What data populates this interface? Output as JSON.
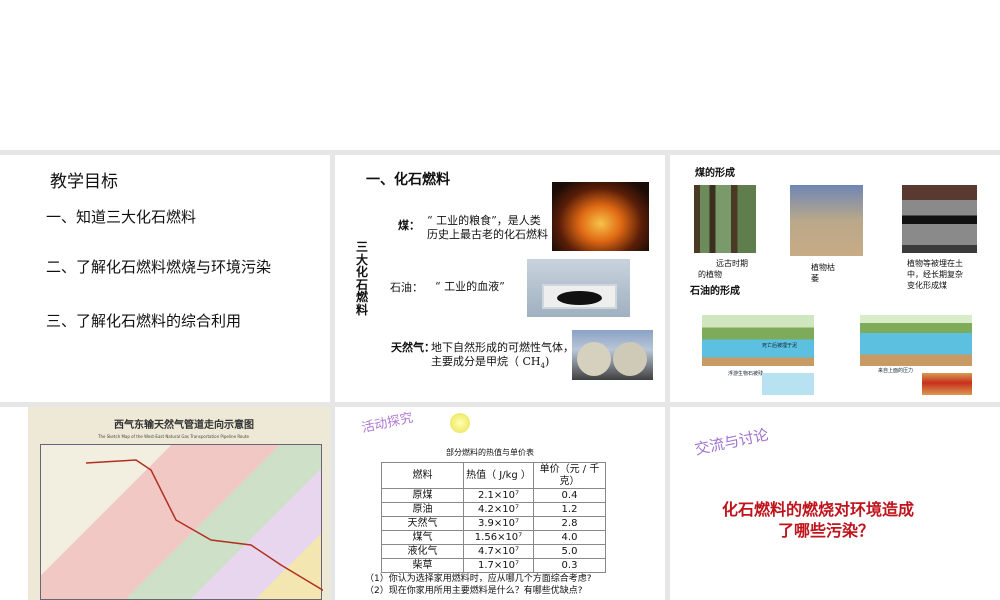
{
  "slide1": {
    "title": "教学目标",
    "items": [
      "一、知道三大化石燃料",
      "二、了解化石燃料燃烧与环境污染",
      "三、了解化石燃料的综合利用"
    ]
  },
  "slide2": {
    "title": "一、化石燃料",
    "side_label": "三大化石燃料",
    "coal_label": "煤：",
    "coal_text_1": "“ 工业的粮食”，是人类",
    "coal_text_2": "历史上最古老的化石燃料",
    "oil_label": "石油：",
    "oil_text": "“ 工业的血液”",
    "gas_label": "天然气：",
    "gas_text_1": "地下自然形成的可燃性气体，",
    "gas_text_2": "主要成分是甲烷（ CH",
    "gas_sub": "4",
    "gas_text_3": ")"
  },
  "slide3": {
    "coal_title": "煤的形成",
    "captions": [
      "远古时期的植物",
      "植物枯萎",
      "植物等被埋在土中，经长期复杂变化形成煤"
    ],
    "oil_title": "石油的形成",
    "oil_captions": [
      "死亡后被埋于泥",
      "浮游生物石被残",
      "来自上面的压力"
    ]
  },
  "slide4": {
    "title": "西气东输天然气管道走向示意图",
    "subtitle": "The Sketch Map of the West-East Natural Gas Transportation Pipeline Route"
  },
  "slide5": {
    "tag": "活动探究",
    "table_title": "部分燃料的热值与单价表",
    "headers": [
      "燃料",
      "热值（ J/kg ）",
      "单价（元 / 千克）"
    ],
    "rows": [
      [
        "原煤",
        "2.1×10⁷",
        "0.4"
      ],
      [
        "原油",
        "4.2×10⁷",
        "1.2"
      ],
      [
        "天然气",
        "3.9×10⁷",
        "2.8"
      ],
      [
        "煤气",
        "1.56×10⁷",
        "4.0"
      ],
      [
        "液化气",
        "4.7×10⁷",
        "5.0"
      ],
      [
        "柴草",
        "1.7×10⁷",
        "0.3"
      ]
    ],
    "q1": "（1）你认为选择家用燃料时，应从哪几个方面综合考虑?",
    "q2": "（2）现在你家用所用主要燃料是什么？有哪些优缺点?"
  },
  "slide6": {
    "tag": "交流与讨论",
    "question_1": "化石燃料的燃烧对环境造成",
    "question_2": "了哪些污染？",
    "question_color": "#c0141c"
  }
}
